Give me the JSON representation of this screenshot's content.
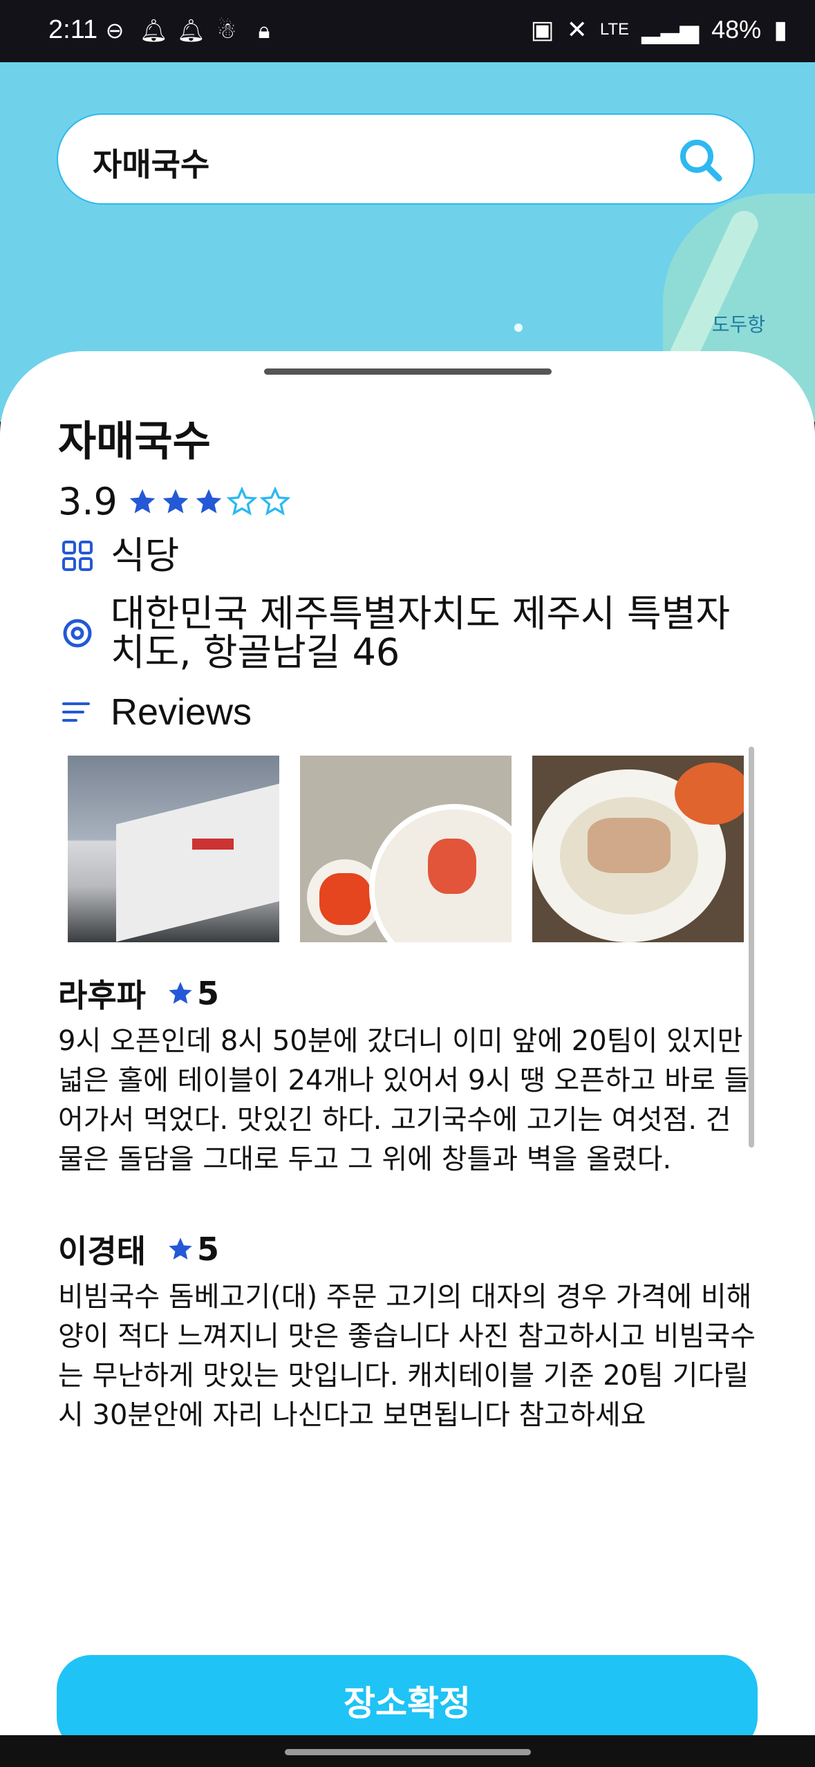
{
  "status_bar": {
    "time": "2:11",
    "battery": "48%",
    "network": "LTE"
  },
  "map": {
    "place_label": "도두항"
  },
  "search": {
    "value": "자매국수"
  },
  "place": {
    "name": "자매국수",
    "rating": "3.9",
    "rating_value": 3,
    "rating_max": 5,
    "category": "식당",
    "address": "대한민국 제주특별자치도 제주시 특별자치도, 항골남길 46",
    "reviews_heading": "Reviews"
  },
  "photos": [
    {
      "name": "review-photo-building"
    },
    {
      "name": "review-photo-bibim-noodles"
    },
    {
      "name": "review-photo-pork-noodle-soup"
    }
  ],
  "reviews": [
    {
      "author": "라후파",
      "score": "5",
      "text": "9시 오픈인데 8시 50분에 갔더니 이미 앞에 20팀이 있지만 넓은 홀에 테이블이 24개나 있어서 9시 땡 오픈하고 바로 들어가서 먹었다. 맛있긴 하다. 고기국수에 고기는 여섯점. 건물은 돌담을 그대로 두고 그 위에 창틀과 벽을 올렸다."
    },
    {
      "author": "이경태",
      "score": "5",
      "text": "비빔국수 돔베고기(대) 주문 고기의 대자의 경우 가격에 비해 양이 적다 느껴지니 맛은 좋습니다 사진 참고하시고 비빔국수는 무난하게 맛있는 맛입니다. 캐치테이블 기준 20팀 기다릴시 30분안에 자리 나신다고 보면됩니다 참고하세요"
    }
  ],
  "confirm_button": {
    "label": "장소확정"
  },
  "colors": {
    "accent": "#1fc3f5",
    "star_fill": "#2458d6",
    "star_empty": "#2db8f0",
    "map_water": "#6fd2ea"
  }
}
